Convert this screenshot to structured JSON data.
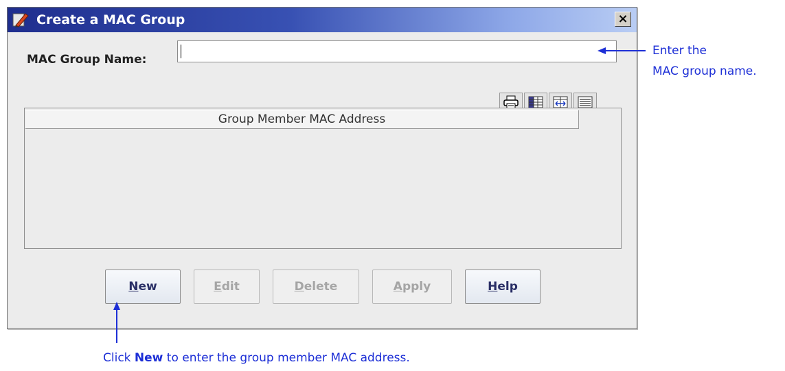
{
  "window": {
    "title": "Create a MAC Group",
    "close_glyph": "×"
  },
  "form": {
    "name_label": "MAC Group Name:",
    "name_value": "",
    "name_placeholder": ""
  },
  "toolbar": {
    "icons": [
      "print-icon",
      "table-select-icon",
      "fit-columns-icon",
      "list-view-icon"
    ]
  },
  "table": {
    "columns": [
      "Group Member MAC Address"
    ],
    "rows": []
  },
  "buttons": [
    {
      "label": "New",
      "mnemonic": "N",
      "enabled": true
    },
    {
      "label": "Edit",
      "mnemonic": "E",
      "enabled": false
    },
    {
      "label": "Delete",
      "mnemonic": "D",
      "enabled": false
    },
    {
      "label": "Apply",
      "mnemonic": "A",
      "enabled": false
    },
    {
      "label": "Help",
      "mnemonic": "H",
      "enabled": true
    }
  ],
  "annotations": {
    "name_hint_line1": "Enter the",
    "name_hint_line2": "MAC group name.",
    "new_hint_prefix": "Click ",
    "new_hint_bold": "New",
    "new_hint_suffix": " to enter the group member MAC address."
  },
  "colors": {
    "annotation": "#1d2fd6",
    "titlebar_start": "#1f2e8e",
    "titlebar_end": "#b9cdf4"
  }
}
